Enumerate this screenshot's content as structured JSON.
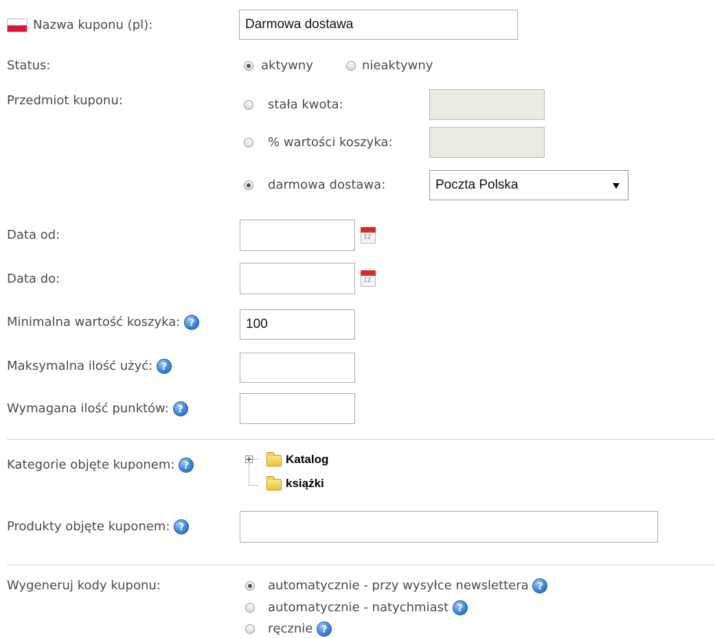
{
  "coupon_name": {
    "label": "Nazwa kuponu (pl):",
    "value": "Darmowa dostawa"
  },
  "status": {
    "label": "Status:",
    "options": [
      "aktywny",
      "nieaktywny"
    ],
    "selected": "aktywny"
  },
  "subject": {
    "label": "Przedmiot kuponu:",
    "fixed_amount": "stała kwota:",
    "percent_cart": "% wartości koszyka:",
    "free_shipping": "darmowa dostawa:",
    "shipping_selected": "Poczta Polska",
    "selected": "darmowa dostawa"
  },
  "date_from": {
    "label": "Data od:",
    "value": ""
  },
  "date_to": {
    "label": "Data do:",
    "value": ""
  },
  "calendar_day": "12",
  "help_glyph": "?",
  "min_cart": {
    "label": "Minimalna wartość koszyka:",
    "value": "100"
  },
  "max_uses": {
    "label": "Maksymalna ilość użyć:",
    "value": ""
  },
  "required_points": {
    "label": "Wymagana ilość punktów:",
    "value": ""
  },
  "categories": {
    "label": "Kategorie objęte kuponem:",
    "tree": [
      {
        "label": "Katalog",
        "expandable": true
      },
      {
        "label": "książki",
        "expandable": false
      }
    ]
  },
  "products": {
    "label": "Produkty objęte kuponem:",
    "value": ""
  },
  "generate_codes": {
    "label": "Wygeneruj kody kuponu:",
    "options": [
      "automatycznie - przy wysyłce newslettera",
      "automatycznie - natychmiast",
      "ręcznie"
    ],
    "selected": "automatycznie - przy wysyłce newslettera"
  },
  "colors": {
    "flag_white": "#ffffff",
    "flag_red": "#dc143c",
    "help_blue": "#3d86dc",
    "disabled_bg": "#ebebe4"
  }
}
